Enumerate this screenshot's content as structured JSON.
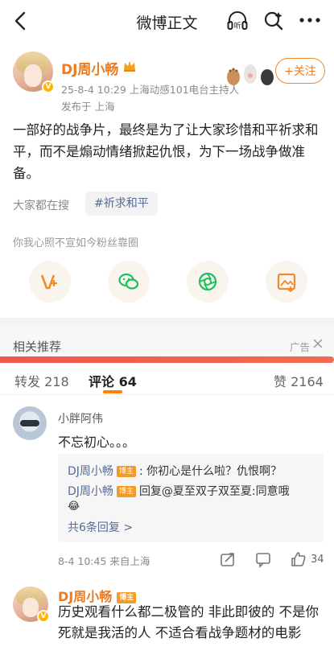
{
  "nav": {
    "title": "微博正文",
    "listen_label": "听"
  },
  "post": {
    "author": "DJ周小畅",
    "meta_line": "25-8-4 10:29   上海动感101电台主持人",
    "location": "发布于 上海",
    "follow_label": "+关注",
    "text": "一部好的战争片，最终是为了让大家珍惜和平祈求和平，而不是煽动情绪掀起仇恨，为下一场战争做准备。",
    "search_label": "大家都在搜",
    "hashtag": "#祈求和平",
    "fan_line": "你我心照不宣如今粉丝靠圈"
  },
  "related": {
    "label": "相关推荐",
    "ad_label": "广告",
    "progress": 1.0
  },
  "tabs": {
    "repost": "转发 218",
    "comment": "评论 64",
    "like": "赞 2164"
  },
  "comments": [
    {
      "name": "小胖阿伟",
      "text": "不忘初心。。。",
      "replies": [
        {
          "name": "DJ周小畅",
          "badge": "博主",
          "text": ": 你初心是什么啦？仇恨啊？"
        },
        {
          "name": "DJ周小畅",
          "badge": "博主",
          "text": "回复@夏至双子双至夏:同意哦"
        }
      ],
      "reply_emoji": "😂",
      "more_replies": "共6条回复 >",
      "meta": "8-4 10:45  来自上海",
      "likes": "34"
    },
    {
      "name": "DJ周小畅",
      "badge": "博主",
      "text": "历史观看什么都二极管的 非此即彼的 不是你死就是我活的人 不适合看战争题材的电影"
    }
  ],
  "colors": {
    "accent": "#eb7a20",
    "link": "#576b95",
    "progress": "#f0584a"
  }
}
